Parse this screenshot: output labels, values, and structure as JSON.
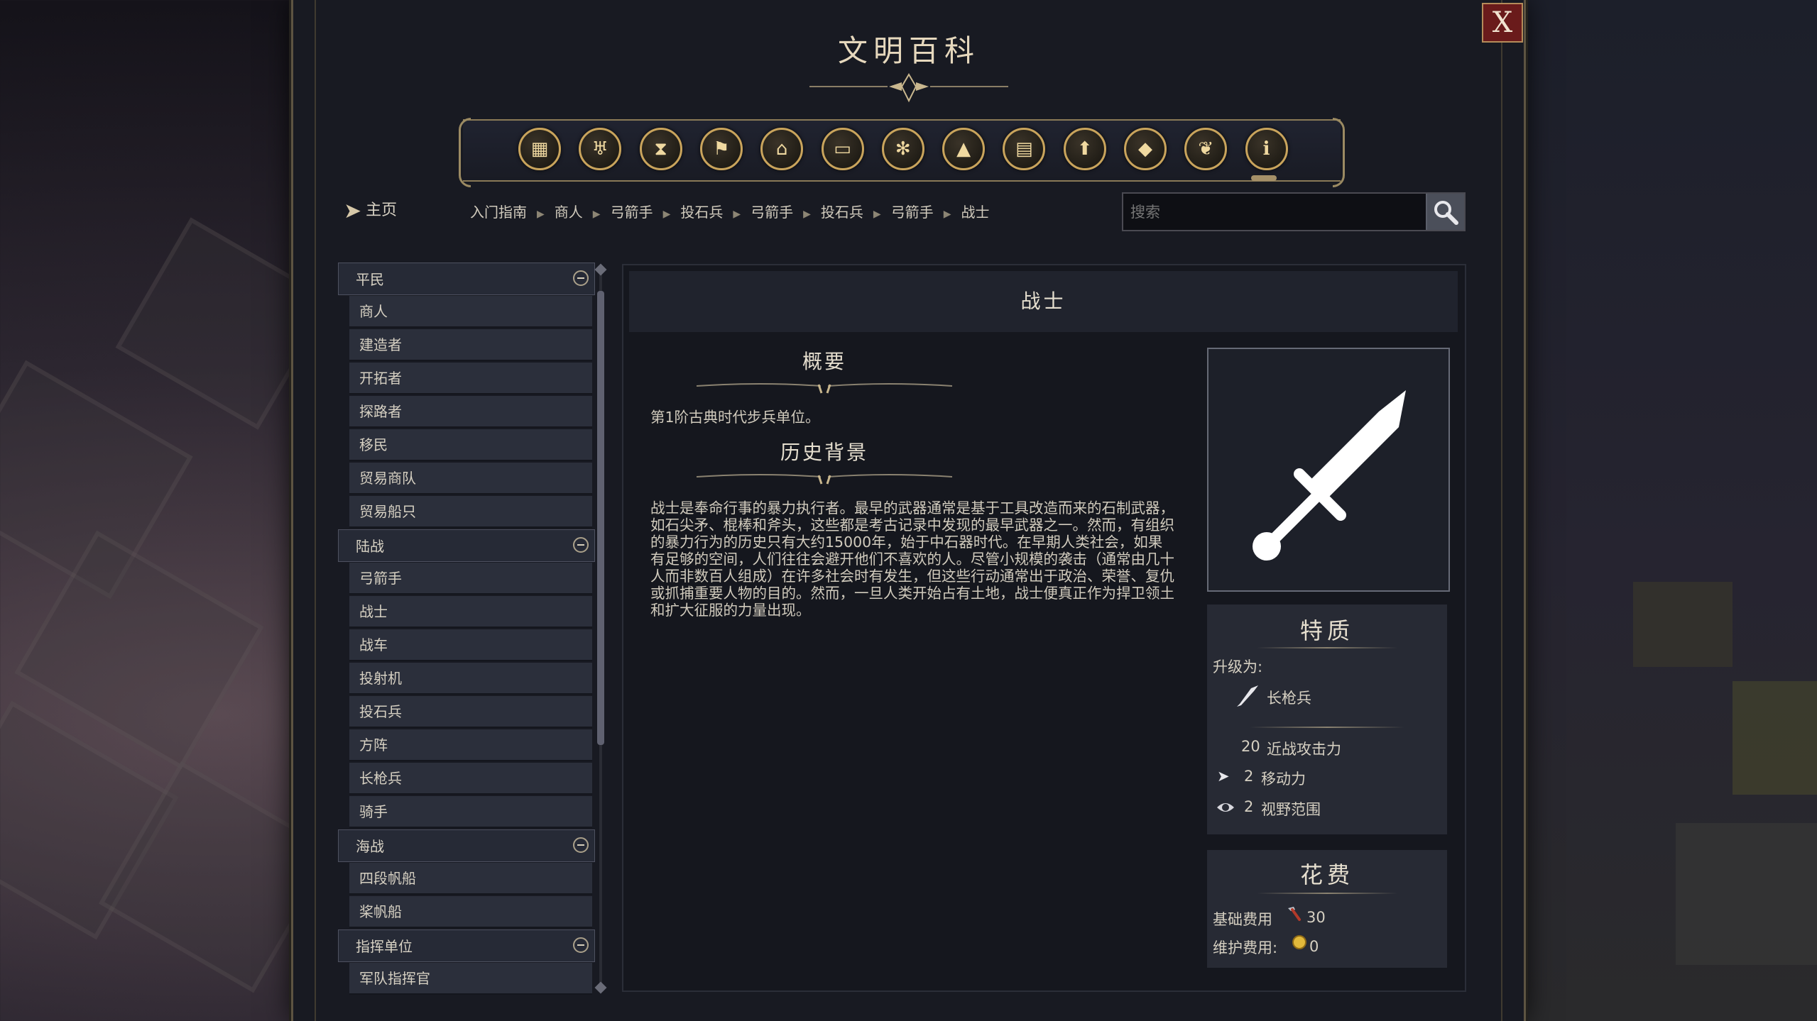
{
  "window": {
    "title": "文明百科",
    "close_label": "X"
  },
  "toolbar": {
    "icons": [
      {
        "name": "resources-icon",
        "glyph": "▦"
      },
      {
        "name": "goblet-icon",
        "glyph": "♅"
      },
      {
        "name": "hourglass-icon",
        "glyph": "⧗"
      },
      {
        "name": "flag-icon",
        "glyph": "⚑"
      },
      {
        "name": "government-building-icon",
        "glyph": "⌂"
      },
      {
        "name": "open-book-icon",
        "glyph": "▭"
      },
      {
        "name": "atom-icon",
        "glyph": "✻"
      },
      {
        "name": "mountains-icon",
        "glyph": "▲"
      },
      {
        "name": "city-building-icon",
        "glyph": "▤"
      },
      {
        "name": "upgrade-arrow-icon",
        "glyph": "⬆"
      },
      {
        "name": "pyramid-icon",
        "glyph": "◆"
      },
      {
        "name": "dove-icon",
        "glyph": "❦"
      },
      {
        "name": "info-icon",
        "glyph": "i"
      }
    ]
  },
  "nav": {
    "home_label": "主页",
    "breadcrumb": [
      "入门指南",
      "商人",
      "弓箭手",
      "投石兵",
      "弓箭手",
      "投石兵",
      "弓箭手",
      "战士"
    ]
  },
  "search": {
    "placeholder": "搜索"
  },
  "sidebar": {
    "categories": [
      {
        "label": "平民",
        "items": [
          "商人",
          "建造者",
          "开拓者",
          "探路者",
          "移民",
          "贸易商队",
          "贸易船只"
        ]
      },
      {
        "label": "陆战",
        "items": [
          "弓箭手",
          "战士",
          "战车",
          "投射机",
          "投石兵",
          "方阵",
          "长枪兵",
          "骑手"
        ]
      },
      {
        "label": "海战",
        "items": [
          "四段帆船",
          "桨帆船"
        ]
      },
      {
        "label": "指挥单位",
        "items": [
          "军队指挥官"
        ]
      }
    ]
  },
  "article": {
    "title": "战士",
    "summary_heading": "概要",
    "summary_text": "第1阶古典时代步兵单位。",
    "history_heading": "历史背景",
    "history_text": "战士是奉命行事的暴力执行者。最早的武器通常是基于工具改造而来的石制武器，如石尖矛、棍棒和斧头，这些都是考古记录中发现的最早武器之一。然而，有组织的暴力行为的历史只有大约15000年，始于中石器时代。在早期人类社会，如果有足够的空间，人们往往会避开他们不喜欢的人。尽管小规模的袭击（通常由几十人而非数百人组成）在许多社会时有发生，但这些行动通常出于政治、荣誉、复仇或抓捕重要人物的目的。然而，一旦人类开始占有土地，战士便真正作为捍卫领土和扩大征服的力量出现。"
  },
  "traits": {
    "heading": "特质",
    "upgrade_label": "升级为:",
    "upgrade_unit": "长枪兵",
    "melee_value": "20",
    "melee_label": "近战攻击力",
    "move_value": "2",
    "move_label": "移动力",
    "sight_value": "2",
    "sight_label": "视野范围"
  },
  "cost": {
    "heading": "花费",
    "base_label": "基础费用",
    "base_value": "30",
    "upkeep_label": "维护费用:",
    "upkeep_value": "0"
  },
  "colors": {
    "accent_gold": "#c9a45c",
    "close_red": "#6a1b1b",
    "panel_bg": "#181a22"
  }
}
